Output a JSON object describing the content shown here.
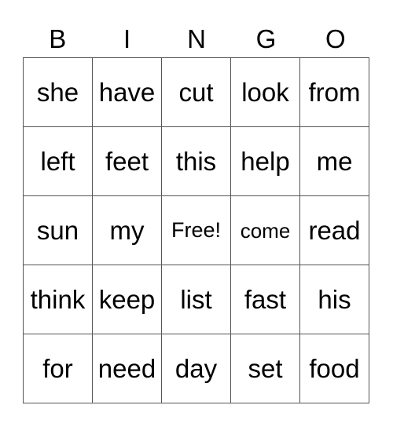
{
  "header": [
    "B",
    "I",
    "N",
    "G",
    "O"
  ],
  "rows": [
    [
      "she",
      "have",
      "cut",
      "look",
      "from"
    ],
    [
      "left",
      "feet",
      "this",
      "help",
      "me"
    ],
    [
      "sun",
      "my",
      "Free!",
      "come",
      "read"
    ],
    [
      "think",
      "keep",
      "list",
      "fast",
      "his"
    ],
    [
      "for",
      "need",
      "day",
      "set",
      "food"
    ]
  ]
}
